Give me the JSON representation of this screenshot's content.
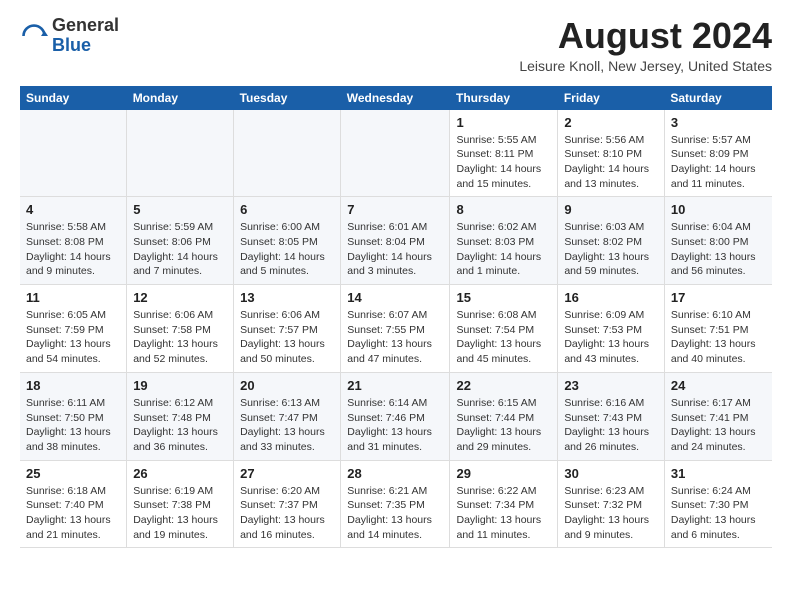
{
  "header": {
    "logo_general": "General",
    "logo_blue": "Blue",
    "month_year": "August 2024",
    "location": "Leisure Knoll, New Jersey, United States"
  },
  "calendar": {
    "days_of_week": [
      "Sunday",
      "Monday",
      "Tuesday",
      "Wednesday",
      "Thursday",
      "Friday",
      "Saturday"
    ],
    "weeks": [
      {
        "days": [
          {
            "num": "",
            "info": ""
          },
          {
            "num": "",
            "info": ""
          },
          {
            "num": "",
            "info": ""
          },
          {
            "num": "",
            "info": ""
          },
          {
            "num": "1",
            "info": "Sunrise: 5:55 AM\nSunset: 8:11 PM\nDaylight: 14 hours and 15 minutes."
          },
          {
            "num": "2",
            "info": "Sunrise: 5:56 AM\nSunset: 8:10 PM\nDaylight: 14 hours and 13 minutes."
          },
          {
            "num": "3",
            "info": "Sunrise: 5:57 AM\nSunset: 8:09 PM\nDaylight: 14 hours and 11 minutes."
          }
        ]
      },
      {
        "days": [
          {
            "num": "4",
            "info": "Sunrise: 5:58 AM\nSunset: 8:08 PM\nDaylight: 14 hours and 9 minutes."
          },
          {
            "num": "5",
            "info": "Sunrise: 5:59 AM\nSunset: 8:06 PM\nDaylight: 14 hours and 7 minutes."
          },
          {
            "num": "6",
            "info": "Sunrise: 6:00 AM\nSunset: 8:05 PM\nDaylight: 14 hours and 5 minutes."
          },
          {
            "num": "7",
            "info": "Sunrise: 6:01 AM\nSunset: 8:04 PM\nDaylight: 14 hours and 3 minutes."
          },
          {
            "num": "8",
            "info": "Sunrise: 6:02 AM\nSunset: 8:03 PM\nDaylight: 14 hours and 1 minute."
          },
          {
            "num": "9",
            "info": "Sunrise: 6:03 AM\nSunset: 8:02 PM\nDaylight: 13 hours and 59 minutes."
          },
          {
            "num": "10",
            "info": "Sunrise: 6:04 AM\nSunset: 8:00 PM\nDaylight: 13 hours and 56 minutes."
          }
        ]
      },
      {
        "days": [
          {
            "num": "11",
            "info": "Sunrise: 6:05 AM\nSunset: 7:59 PM\nDaylight: 13 hours and 54 minutes."
          },
          {
            "num": "12",
            "info": "Sunrise: 6:06 AM\nSunset: 7:58 PM\nDaylight: 13 hours and 52 minutes."
          },
          {
            "num": "13",
            "info": "Sunrise: 6:06 AM\nSunset: 7:57 PM\nDaylight: 13 hours and 50 minutes."
          },
          {
            "num": "14",
            "info": "Sunrise: 6:07 AM\nSunset: 7:55 PM\nDaylight: 13 hours and 47 minutes."
          },
          {
            "num": "15",
            "info": "Sunrise: 6:08 AM\nSunset: 7:54 PM\nDaylight: 13 hours and 45 minutes."
          },
          {
            "num": "16",
            "info": "Sunrise: 6:09 AM\nSunset: 7:53 PM\nDaylight: 13 hours and 43 minutes."
          },
          {
            "num": "17",
            "info": "Sunrise: 6:10 AM\nSunset: 7:51 PM\nDaylight: 13 hours and 40 minutes."
          }
        ]
      },
      {
        "days": [
          {
            "num": "18",
            "info": "Sunrise: 6:11 AM\nSunset: 7:50 PM\nDaylight: 13 hours and 38 minutes."
          },
          {
            "num": "19",
            "info": "Sunrise: 6:12 AM\nSunset: 7:48 PM\nDaylight: 13 hours and 36 minutes."
          },
          {
            "num": "20",
            "info": "Sunrise: 6:13 AM\nSunset: 7:47 PM\nDaylight: 13 hours and 33 minutes."
          },
          {
            "num": "21",
            "info": "Sunrise: 6:14 AM\nSunset: 7:46 PM\nDaylight: 13 hours and 31 minutes."
          },
          {
            "num": "22",
            "info": "Sunrise: 6:15 AM\nSunset: 7:44 PM\nDaylight: 13 hours and 29 minutes."
          },
          {
            "num": "23",
            "info": "Sunrise: 6:16 AM\nSunset: 7:43 PM\nDaylight: 13 hours and 26 minutes."
          },
          {
            "num": "24",
            "info": "Sunrise: 6:17 AM\nSunset: 7:41 PM\nDaylight: 13 hours and 24 minutes."
          }
        ]
      },
      {
        "days": [
          {
            "num": "25",
            "info": "Sunrise: 6:18 AM\nSunset: 7:40 PM\nDaylight: 13 hours and 21 minutes."
          },
          {
            "num": "26",
            "info": "Sunrise: 6:19 AM\nSunset: 7:38 PM\nDaylight: 13 hours and 19 minutes."
          },
          {
            "num": "27",
            "info": "Sunrise: 6:20 AM\nSunset: 7:37 PM\nDaylight: 13 hours and 16 minutes."
          },
          {
            "num": "28",
            "info": "Sunrise: 6:21 AM\nSunset: 7:35 PM\nDaylight: 13 hours and 14 minutes."
          },
          {
            "num": "29",
            "info": "Sunrise: 6:22 AM\nSunset: 7:34 PM\nDaylight: 13 hours and 11 minutes."
          },
          {
            "num": "30",
            "info": "Sunrise: 6:23 AM\nSunset: 7:32 PM\nDaylight: 13 hours and 9 minutes."
          },
          {
            "num": "31",
            "info": "Sunrise: 6:24 AM\nSunset: 7:30 PM\nDaylight: 13 hours and 6 minutes."
          }
        ]
      }
    ]
  }
}
